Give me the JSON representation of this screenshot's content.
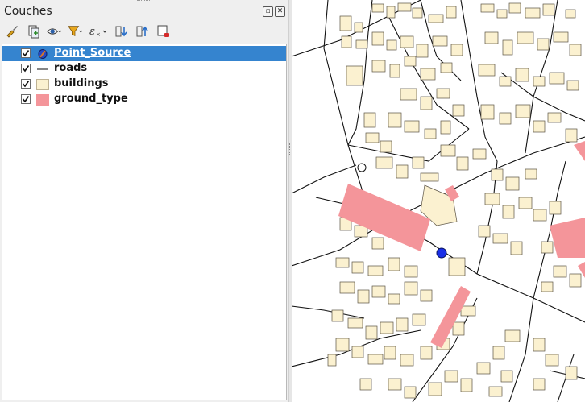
{
  "panel": {
    "title": "Couches",
    "buttons": [
      "float-icon",
      "close-icon"
    ]
  },
  "toolbar": {
    "tools": [
      {
        "name": "style-brush-icon"
      },
      {
        "name": "add-group-icon"
      },
      {
        "name": "visibility-eye-icon"
      },
      {
        "name": "filter-icon"
      },
      {
        "name": "expression-filter-icon"
      },
      {
        "name": "expand-all-icon"
      },
      {
        "name": "collapse-all-icon"
      },
      {
        "name": "remove-layer-icon"
      }
    ]
  },
  "layers": [
    {
      "name": "Point_Source",
      "checked": true,
      "symbol": "point-icon",
      "selected": true
    },
    {
      "name": "roads",
      "checked": true,
      "symbol": "line-icon",
      "selected": false
    },
    {
      "name": "buildings",
      "checked": true,
      "symbol": "polygon-icon",
      "color": "#fbf1d0",
      "selected": false
    },
    {
      "name": "ground_type",
      "checked": true,
      "symbol": "polygon-icon",
      "color": "#f4959a",
      "selected": false
    }
  ],
  "map": {
    "building_fill": "#fbf1d0",
    "ground_fill": "#f4959a",
    "point_fill": "#1a2fe6",
    "road_color": "#111111"
  }
}
